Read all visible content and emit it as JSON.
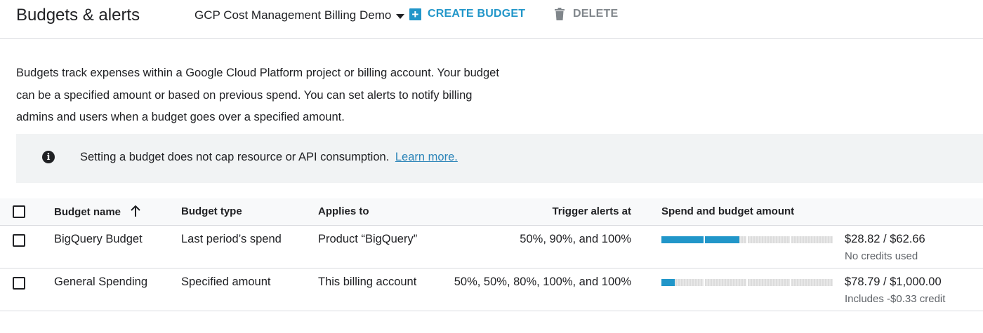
{
  "header": {
    "title": "Budgets & alerts",
    "project": "GCP Cost Management Billing Demo",
    "create_label": "CREATE BUDGET",
    "delete_label": "DELETE"
  },
  "description": "Budgets track expenses within a Google Cloud Platform project or billing account. Your budget can be a specified amount or based on previous spend. You can set alerts to notify billing admins and users when a budget goes over a specified amount.",
  "banner": {
    "text": "Setting a budget does not cap resource or API consumption.",
    "link": "Learn more."
  },
  "table": {
    "columns": {
      "name": "Budget name",
      "type": "Budget type",
      "applies": "Applies to",
      "trigger": "Trigger alerts at",
      "spend": "Spend and budget amount"
    },
    "rows": [
      {
        "name": "BigQuery Budget",
        "type": "Last period’s spend",
        "applies": "Product “BigQuery”",
        "trigger": "50%, 90%, and 100%",
        "amount": "$28.82 / $62.66",
        "credit": "No credits used",
        "progress": 0.46
      },
      {
        "name": "General Spending",
        "type": "Specified amount",
        "applies": "This billing account",
        "trigger": "50%, 50%, 80%, 100%, and 100%",
        "amount": "$78.79 / $1,000.00",
        "credit": "Includes -$0.33 credit",
        "progress": 0.08
      }
    ]
  },
  "colors": {
    "accent": "#2196c9",
    "progress_track": "#e0e0e0"
  }
}
